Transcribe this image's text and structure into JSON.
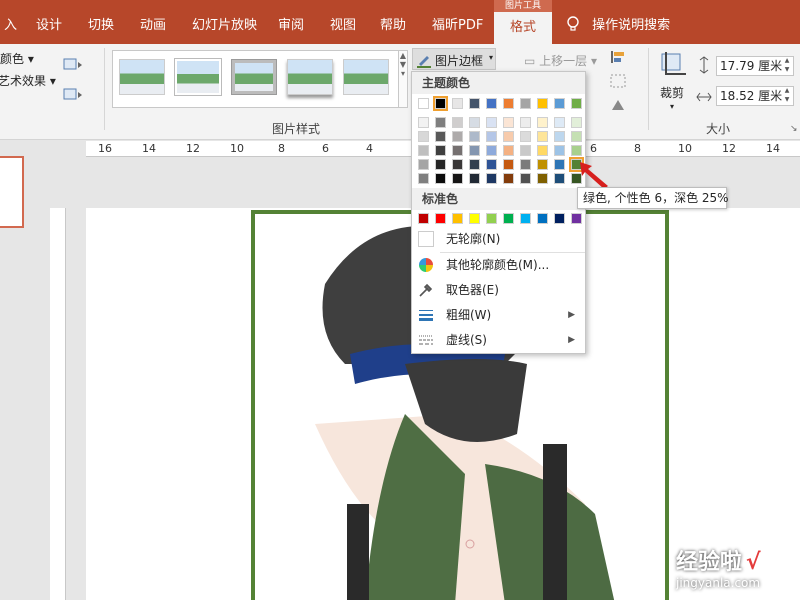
{
  "tabs": [
    {
      "label": "入"
    },
    {
      "label": "设计"
    },
    {
      "label": "切换"
    },
    {
      "label": "动画"
    },
    {
      "label": "幻灯片放映"
    },
    {
      "label": "审阅"
    },
    {
      "label": "视图"
    },
    {
      "label": "帮助"
    },
    {
      "label": "福昕PDF"
    },
    {
      "label": "格式"
    }
  ],
  "context_tab_label": "图片工具",
  "search_label": "操作说明搜索",
  "ribbon": {
    "color_label": "颜色",
    "artistic_label": "艺术效果",
    "picture_styles_group": "图片样式",
    "border_button": "图片边框",
    "bring_forward": "上移一层",
    "crop_label": "裁剪",
    "size_group": "大小",
    "height_value": "17.79 厘米",
    "width_value": "18.52 厘米"
  },
  "ruler_labels": [
    "16",
    "14",
    "12",
    "10",
    "8",
    "6",
    "4",
    "6",
    "8",
    "10",
    "12",
    "14"
  ],
  "dropdown": {
    "theme_header": "主题颜色",
    "standard_header": "标准色",
    "no_outline": "无轮廓(N)",
    "more_colors": "其他轮廓颜色(M)...",
    "eyedropper": "取色器(E)",
    "weight": "粗细(W)",
    "dashes": "虚线(S)"
  },
  "colors": {
    "theme_top": [
      "#ffffff",
      "#000000",
      "#e7e6e6",
      "#44546a",
      "#4472c4",
      "#ed7d31",
      "#a5a5a5",
      "#ffc000",
      "#5b9bd5",
      "#70ad47"
    ],
    "theme_shades": [
      [
        "#f2f2f2",
        "#7f7f7f",
        "#d0cece",
        "#d6dce4",
        "#d9e2f3",
        "#fbe5d5",
        "#ededed",
        "#fff2cc",
        "#deeaf6",
        "#e2efd9"
      ],
      [
        "#d8d8d8",
        "#595959",
        "#aeabab",
        "#adb9ca",
        "#b4c6e7",
        "#f7cbac",
        "#dbdbdb",
        "#fee599",
        "#bdd7ee",
        "#c5e0b3"
      ],
      [
        "#bfbfbf",
        "#3f3f3f",
        "#757070",
        "#8496b0",
        "#8eaadb",
        "#f4b183",
        "#c9c9c9",
        "#ffd965",
        "#9dc3e6",
        "#a8d08d"
      ],
      [
        "#a5a5a5",
        "#262626",
        "#3a3838",
        "#323f4f",
        "#2f5496",
        "#c55a11",
        "#7b7b7b",
        "#bf9000",
        "#2e75b5",
        "#538135"
      ],
      [
        "#7f7f7f",
        "#0c0c0c",
        "#171616",
        "#222a35",
        "#1e3864",
        "#833c0b",
        "#525252",
        "#7f6000",
        "#1e4e79",
        "#375623"
      ]
    ],
    "standard": [
      "#c00000",
      "#ff0000",
      "#ffc000",
      "#ffff00",
      "#92d050",
      "#00b050",
      "#00b0f0",
      "#0070c0",
      "#002060",
      "#7030a0"
    ],
    "picture_border": "#548235",
    "ribbon_accent": "#b7472a"
  },
  "tooltip_text": "绿色, 个性色 6，深色 25%",
  "watermark": {
    "title": "经验啦",
    "check": "√",
    "url": "jingyanla.com"
  }
}
